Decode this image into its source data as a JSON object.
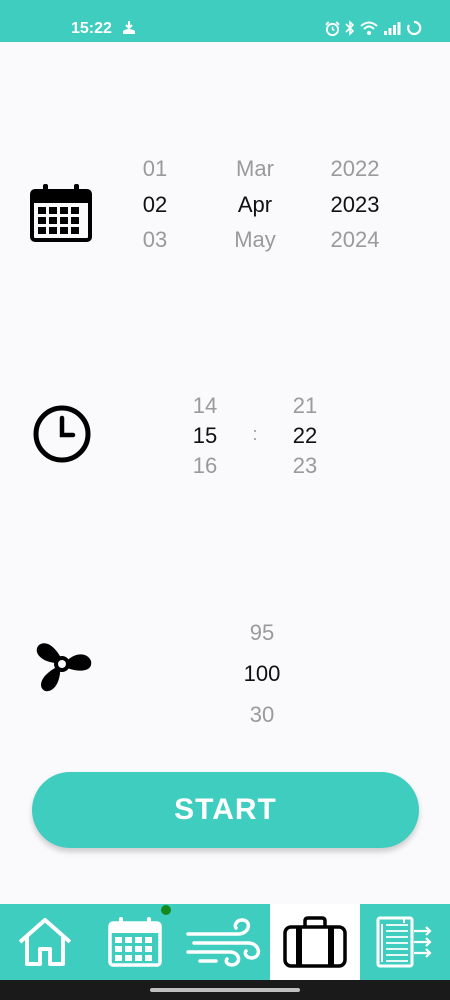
{
  "status_bar": {
    "time": "15:22",
    "accent": "#3ecdbf"
  },
  "date_picker": {
    "icon": "calendar-icon",
    "day": {
      "prev": "01",
      "selected": "02",
      "next": "03"
    },
    "month": {
      "prev": "Mar",
      "selected": "Apr",
      "next": "May"
    },
    "year": {
      "prev": "2022",
      "selected": "2023",
      "next": "2024"
    }
  },
  "time_picker": {
    "icon": "clock-icon",
    "hour": {
      "prev": "14",
      "selected": "15",
      "next": "16"
    },
    "separator": ":",
    "minute": {
      "prev": "21",
      "selected": "22",
      "next": "23"
    }
  },
  "fan_picker": {
    "icon": "fan-icon",
    "value": {
      "prev": "95",
      "selected": "100",
      "next": "30"
    }
  },
  "start_button": {
    "label": "START"
  },
  "bottom_nav": {
    "items": [
      {
        "id": "home",
        "icon": "home-icon",
        "active": false
      },
      {
        "id": "schedule",
        "icon": "calendar-icon",
        "active": false,
        "badge": true
      },
      {
        "id": "air",
        "icon": "wind-icon",
        "active": false
      },
      {
        "id": "travel",
        "icon": "suitcase-icon",
        "active": true
      },
      {
        "id": "heater",
        "icon": "radiator-icon",
        "active": false
      }
    ]
  }
}
